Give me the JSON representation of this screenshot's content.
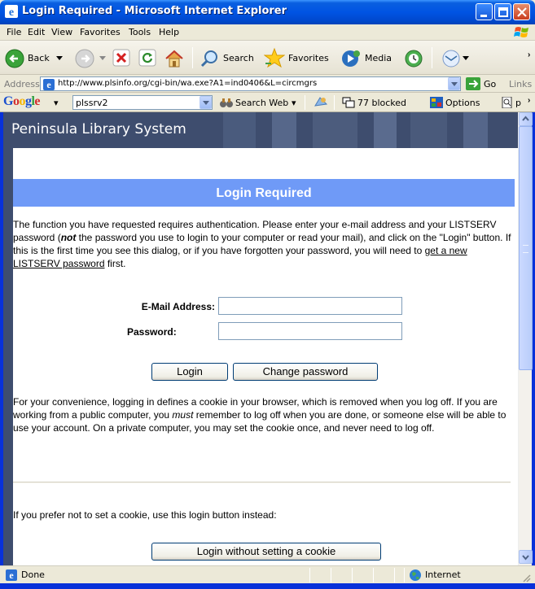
{
  "window": {
    "title": "Login Required - Microsoft Internet Explorer"
  },
  "menu": [
    "File",
    "Edit",
    "View",
    "Favorites",
    "Tools",
    "Help"
  ],
  "toolbar": {
    "back": "Back",
    "search": "Search",
    "favorites": "Favorites",
    "media": "Media"
  },
  "address": {
    "label": "Address",
    "url": "http://www.plsinfo.org/cgi-bin/wa.exe?A1=ind0406&L=circmgrs",
    "go": "Go",
    "links": "Links"
  },
  "googlebar": {
    "logo": "Google",
    "query": "plssrv2",
    "search_web": "Search Web",
    "blocked": "77 blocked",
    "options": "Options",
    "more": "p"
  },
  "page": {
    "site_title": "Peninsula Library System",
    "heading": "Login Required",
    "intro_a": "The function you have requested requires authentication. Please enter your e-mail address and your LISTSERV password (",
    "intro_not": "not",
    "intro_b": " the password you use to login to your computer or read your mail), and click on the \"Login\" button. If this is the first time you see this dialog, or if you have forgotten your password, you will need to ",
    "intro_link": "get a new LISTSERV password",
    "intro_c": " first.",
    "email_label": "E-Mail Address:",
    "password_label": "Password:",
    "login_btn": "Login",
    "change_pw_btn": "Change password",
    "cookie_a": "For your convenience, logging in defines a cookie in your browser, which is removed when you log off. If you are working from a public computer, you ",
    "cookie_must": "must",
    "cookie_b": " remember to log off when you are done, or someone else will be able to use your account. On a private computer, you may set the cookie once, and never need to log off.",
    "no_cookie_text": "If you prefer not to set a cookie, use this login button instead:",
    "no_cookie_btn": "Login without setting a cookie"
  },
  "status": {
    "text": "Done",
    "zone": "Internet"
  }
}
